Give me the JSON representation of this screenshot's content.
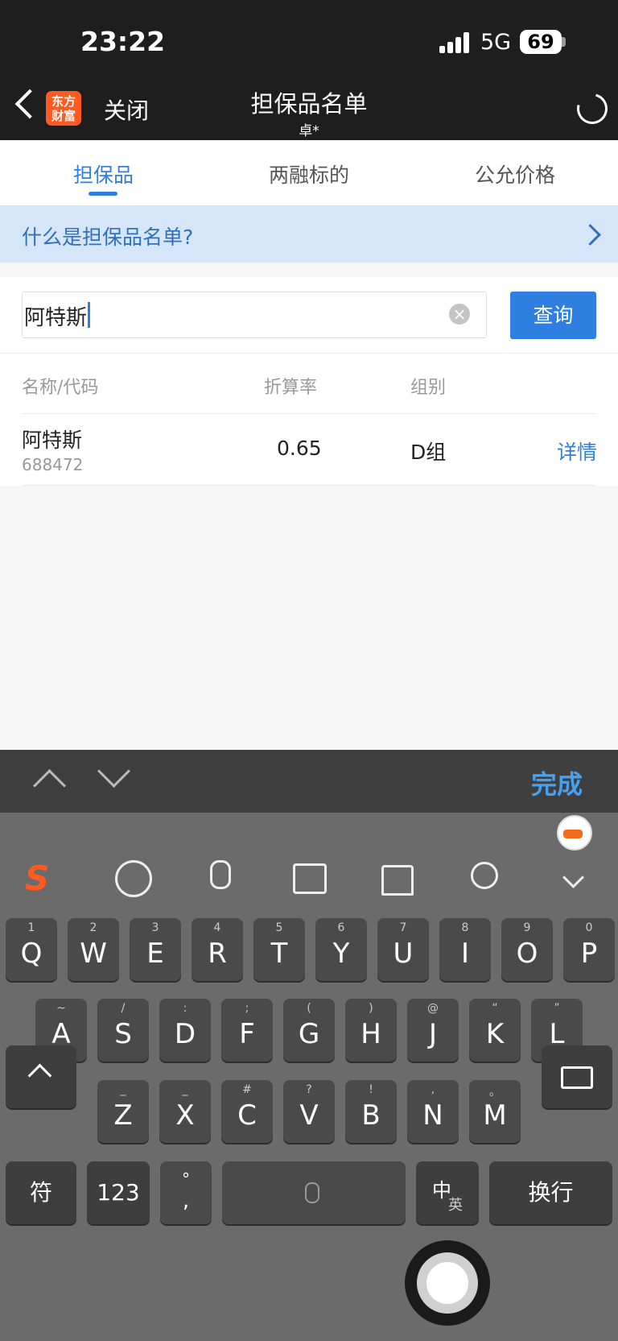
{
  "status_bar": {
    "time": "23:22",
    "network": "5G",
    "battery": "69"
  },
  "nav": {
    "logo_line1": "东方",
    "logo_line2": "财富",
    "close_label": "关闭",
    "title": "担保品名单",
    "subtitle": "卓*"
  },
  "tabs": [
    {
      "label": "担保品",
      "active": true
    },
    {
      "label": "两融标的",
      "active": false
    },
    {
      "label": "公允价格",
      "active": false
    }
  ],
  "banner": {
    "text": "什么是担保品名单?"
  },
  "search": {
    "value": "阿特斯",
    "button_label": "查询",
    "clear_icon": "×"
  },
  "table": {
    "headers": [
      "名称/代码",
      "折算率",
      "组别"
    ],
    "rows": [
      {
        "name": "阿特斯",
        "code": "688472",
        "rate": "0.65",
        "group": "D组",
        "action": "详情"
      }
    ]
  },
  "accessory": {
    "done_label": "完成"
  },
  "keyboard": {
    "row1": [
      {
        "k": "Q",
        "h": "1"
      },
      {
        "k": "W",
        "h": "2"
      },
      {
        "k": "E",
        "h": "3"
      },
      {
        "k": "R",
        "h": "4"
      },
      {
        "k": "T",
        "h": "5"
      },
      {
        "k": "Y",
        "h": "6"
      },
      {
        "k": "U",
        "h": "7"
      },
      {
        "k": "I",
        "h": "8"
      },
      {
        "k": "O",
        "h": "9"
      },
      {
        "k": "P",
        "h": "0"
      }
    ],
    "row2": [
      {
        "k": "A",
        "h": "~"
      },
      {
        "k": "S",
        "h": "/"
      },
      {
        "k": "D",
        "h": ":"
      },
      {
        "k": "F",
        "h": ";"
      },
      {
        "k": "G",
        "h": "("
      },
      {
        "k": "H",
        "h": ")"
      },
      {
        "k": "J",
        "h": "@"
      },
      {
        "k": "K",
        "h": "“"
      },
      {
        "k": "L",
        "h": "”"
      }
    ],
    "row3": [
      {
        "k": "Z",
        "h": "_"
      },
      {
        "k": "X",
        "h": "_"
      },
      {
        "k": "C",
        "h": "#"
      },
      {
        "k": "V",
        "h": "?"
      },
      {
        "k": "B",
        "h": "!"
      },
      {
        "k": "N",
        "h": ","
      },
      {
        "k": "M",
        "h": "。"
      }
    ],
    "symbols_label": "符",
    "numbers_label": "123",
    "punct_top": "°",
    "punct_bottom": ",",
    "lang_main": "中",
    "lang_sub": "英",
    "return_label": "换行"
  }
}
